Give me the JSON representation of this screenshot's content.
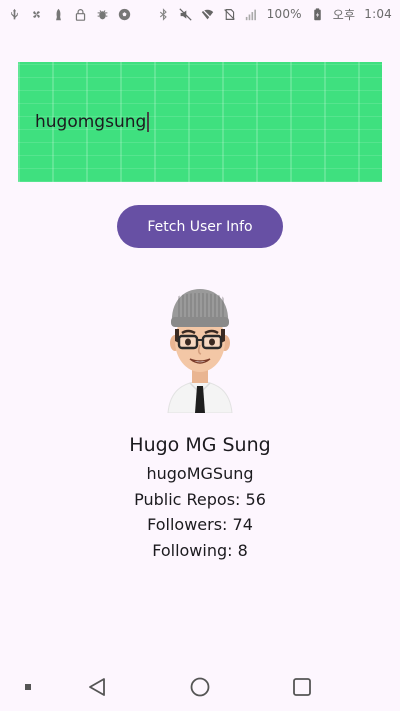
{
  "status_bar": {
    "left_icons": [
      "usb-icon",
      "pinwheel-icon",
      "rocket-icon",
      "lock-icon",
      "bug-icon",
      "soccer-ball-icon"
    ],
    "right_icons": [
      "bluetooth-icon",
      "mute-icon",
      "wifi-icon",
      "no-sim-icon",
      "signal-icon"
    ],
    "battery_percent": "100%",
    "ampm": "오후",
    "time": "1:04"
  },
  "username_field": {
    "value": "hugomgsung",
    "background_color": "#3fe07f"
  },
  "fetch_button": {
    "label": "Fetch User Info",
    "color": "#6750a4"
  },
  "avatar": {
    "icon": "user-avatar-icon"
  },
  "user": {
    "name": "Hugo MG Sung",
    "login": "hugoMGSung",
    "public_repos": "Public Repos: 56",
    "followers": "Followers: 74",
    "following": "Following: 8"
  },
  "nav_bar": {
    "items": [
      "recent-apps-dot-icon",
      "back-icon",
      "home-icon",
      "overview-icon"
    ]
  }
}
